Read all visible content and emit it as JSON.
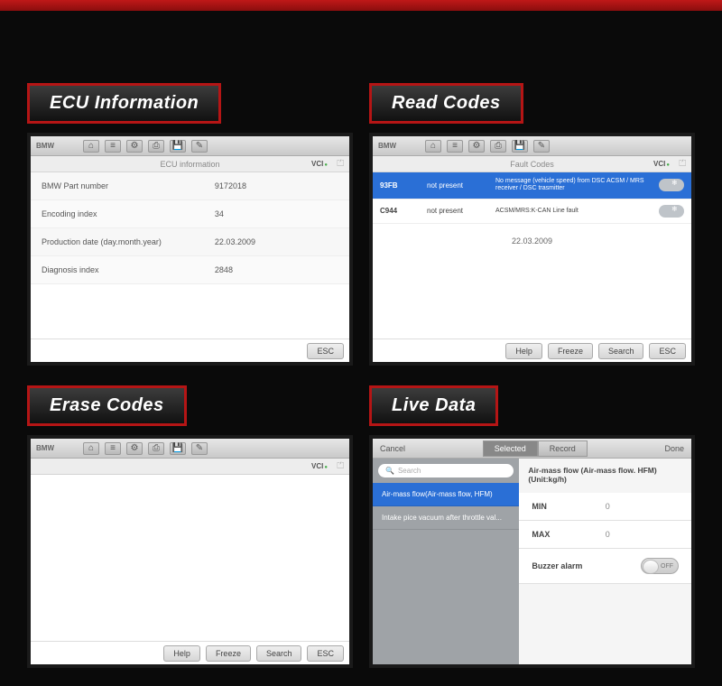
{
  "panels": {
    "ecu": {
      "title": "ECU Information"
    },
    "read": {
      "title": "Read Codes"
    },
    "erase": {
      "title": "Erase Codes"
    },
    "live": {
      "title": "Live Data"
    }
  },
  "toolbar": {
    "brand": "BMW"
  },
  "vci": "VCI",
  "ecu": {
    "header": "ECU information",
    "rows": [
      {
        "label": "BMW Part number",
        "value": "9172018"
      },
      {
        "label": "Encoding index",
        "value": "34"
      },
      {
        "label": "Production date (day.month.year)",
        "value": "22.03.2009"
      },
      {
        "label": "Diagnosis index",
        "value": "2848"
      }
    ],
    "esc": "ESC"
  },
  "read": {
    "header": "Fault Codes",
    "rows": [
      {
        "code": "93FB",
        "status": "not present",
        "desc": "No message (vehicle speed) from DSC ACSM / MRS receiver / DSC trasmitter"
      },
      {
        "code": "C944",
        "status": "not present",
        "desc": "ACSM/MRS:K-CAN Line fault"
      }
    ],
    "date": "22.03.2009",
    "buttons": {
      "help": "Help",
      "freeze": "Freeze",
      "search": "Search",
      "esc": "ESC"
    }
  },
  "erase": {
    "buttons": {
      "help": "Help",
      "freeze": "Freeze",
      "search": "Search",
      "esc": "ESC"
    }
  },
  "live": {
    "top": {
      "cancel": "Cancel",
      "done": "Done",
      "tab_selected": "Selected",
      "tab_record": "Record"
    },
    "search_placeholder": "Search",
    "items": [
      "Air-mass flow(Air-mass flow, HFM)",
      "Intake pice vacuum after throttle val..."
    ],
    "right": {
      "title": "Air-mass flow (Air-mass flow. HFM)(Unit:kg/h)",
      "min_label": "MIN",
      "min_value": "0",
      "max_label": "MAX",
      "max_value": "0",
      "buzzer_label": "Buzzer alarm",
      "switch_text": "OFF"
    }
  }
}
